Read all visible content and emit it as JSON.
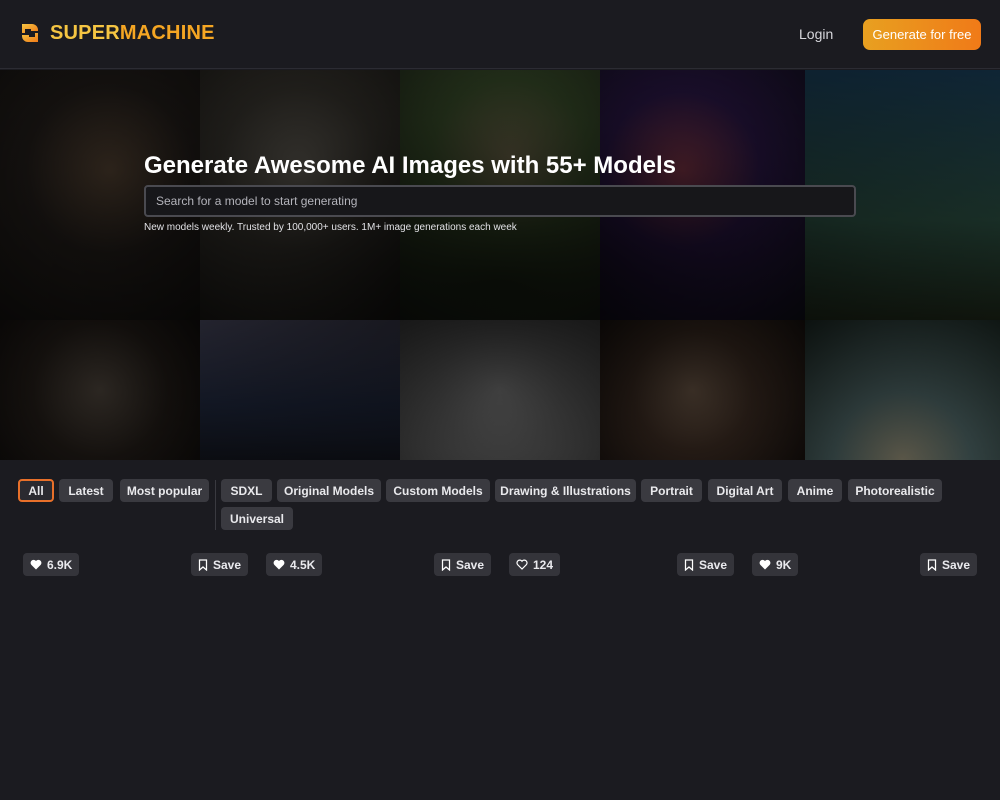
{
  "header": {
    "brand_part1": "SUPER",
    "brand_part2": "MACHINE",
    "login_label": "Login",
    "cta_label": "Generate for free"
  },
  "hero": {
    "title": "Generate Awesome AI Images with 55+ Models",
    "search_placeholder": "Search for a model to start generating",
    "subtitle": "New models weekly. Trusted by 100,000+ users. 1M+ image generations each week"
  },
  "filters": {
    "primary": [
      "All",
      "Latest",
      "Most popular"
    ],
    "categories": [
      "SDXL",
      "Original Models",
      "Custom Models",
      "Drawing & Illustrations",
      "Portrait",
      "Digital Art",
      "Anime",
      "Photorealistic",
      "Universal"
    ],
    "active": "All"
  },
  "cards": [
    {
      "likes": "6.9K",
      "liked": true,
      "save_label": "Save"
    },
    {
      "likes": "4.5K",
      "liked": true,
      "save_label": "Save"
    },
    {
      "likes": "124",
      "liked": false,
      "save_label": "Save"
    },
    {
      "likes": "9K",
      "liked": true,
      "save_label": "Save"
    }
  ],
  "colors": {
    "background": "#1b1b20",
    "accent_start": "#e8a020",
    "accent_end": "#f07a18",
    "active_chip_border": "#e8702a"
  },
  "icons": {
    "logo": "supermachine-logo-icon",
    "like": "heart-icon",
    "save": "bookmark-icon"
  }
}
